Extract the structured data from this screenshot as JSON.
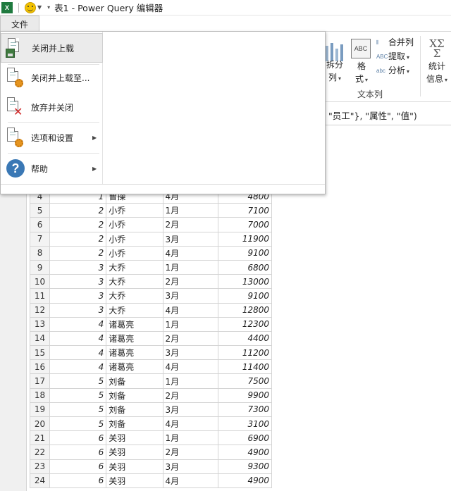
{
  "titlebar": {
    "app_icon": "excel-icon",
    "quick_access_icon": "smiley-icon",
    "title": "表1 - Power Query 编辑器"
  },
  "ribbon": {
    "file_tab": "文件",
    "split_column": "拆分\n列",
    "split_label_top": "拆分",
    "split_label_bottom": "列",
    "format_label": "格\n式",
    "format_top": "格",
    "format_bottom": "式",
    "format_icon_text": "ABC",
    "merge_columns": "合并列",
    "extract": "提取",
    "parse": "分析",
    "statistics_top": "统计",
    "statistics_bottom": "信息",
    "statistics_icon_text": "XΣ",
    "group_label": "文本列"
  },
  "formula_bar": {
    "text": "\"员工\"}, \"属性\", \"值\")"
  },
  "file_menu": {
    "items": [
      {
        "label": "关闭并上载",
        "icon": "close-and-load-icon",
        "has_submenu": false
      },
      {
        "label": "关闭并上载至...",
        "icon": "close-and-load-to-icon",
        "has_submenu": false
      },
      {
        "label": "放弃并关闭",
        "icon": "discard-and-close-icon",
        "has_submenu": false
      },
      {
        "label": "选项和设置",
        "icon": "options-settings-icon",
        "has_submenu": true
      },
      {
        "label": "帮助",
        "icon": "help-icon",
        "has_submenu": true
      }
    ]
  },
  "table": {
    "rows": [
      {
        "row": "4",
        "id": "1",
        "name": "曹操",
        "month": "4月",
        "value": "4800"
      },
      {
        "row": "5",
        "id": "2",
        "name": "小乔",
        "month": "1月",
        "value": "7100"
      },
      {
        "row": "6",
        "id": "2",
        "name": "小乔",
        "month": "2月",
        "value": "7000"
      },
      {
        "row": "7",
        "id": "2",
        "name": "小乔",
        "month": "3月",
        "value": "11900"
      },
      {
        "row": "8",
        "id": "2",
        "name": "小乔",
        "month": "4月",
        "value": "9100"
      },
      {
        "row": "9",
        "id": "3",
        "name": "大乔",
        "month": "1月",
        "value": "6800"
      },
      {
        "row": "10",
        "id": "3",
        "name": "大乔",
        "month": "2月",
        "value": "13000"
      },
      {
        "row": "11",
        "id": "3",
        "name": "大乔",
        "month": "3月",
        "value": "9100"
      },
      {
        "row": "12",
        "id": "3",
        "name": "大乔",
        "month": "4月",
        "value": "12800"
      },
      {
        "row": "13",
        "id": "4",
        "name": "诸葛亮",
        "month": "1月",
        "value": "12300"
      },
      {
        "row": "14",
        "id": "4",
        "name": "诸葛亮",
        "month": "2月",
        "value": "4400"
      },
      {
        "row": "15",
        "id": "4",
        "name": "诸葛亮",
        "month": "3月",
        "value": "11200"
      },
      {
        "row": "16",
        "id": "4",
        "name": "诸葛亮",
        "month": "4月",
        "value": "11400"
      },
      {
        "row": "17",
        "id": "5",
        "name": "刘备",
        "month": "1月",
        "value": "7500"
      },
      {
        "row": "18",
        "id": "5",
        "name": "刘备",
        "month": "2月",
        "value": "9900"
      },
      {
        "row": "19",
        "id": "5",
        "name": "刘备",
        "month": "3月",
        "value": "7300"
      },
      {
        "row": "20",
        "id": "5",
        "name": "刘备",
        "month": "4月",
        "value": "3100"
      },
      {
        "row": "21",
        "id": "6",
        "name": "关羽",
        "month": "1月",
        "value": "6900"
      },
      {
        "row": "22",
        "id": "6",
        "name": "关羽",
        "month": "2月",
        "value": "4900"
      },
      {
        "row": "23",
        "id": "6",
        "name": "关羽",
        "month": "3月",
        "value": "9300"
      },
      {
        "row": "24",
        "id": "6",
        "name": "关羽",
        "month": "4月",
        "value": "4900"
      }
    ]
  }
}
